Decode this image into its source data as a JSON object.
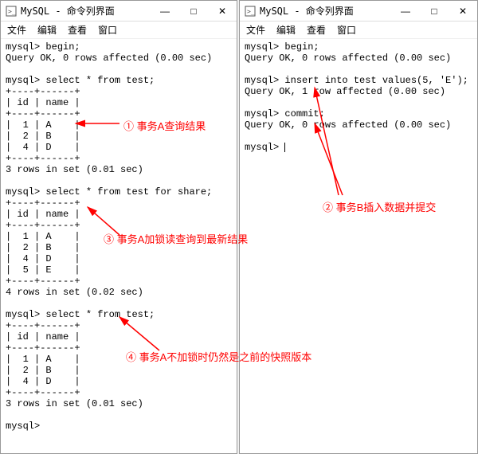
{
  "window_title": "MySQL - 命令列界面",
  "menubar": {
    "file": "文件",
    "edit": "编辑",
    "view": "查看",
    "window": "窗口"
  },
  "left": {
    "prompt": "mysql>",
    "cmd_begin": "begin;",
    "resp_begin": "Query OK, 0 rows affected (0.00 sec)",
    "cmd_select1": "select * from test;",
    "table_sep": "+----+------+",
    "table_hdr": "| id | name |",
    "row_1a": "|  1 | A    |",
    "row_2b": "|  2 | B    |",
    "row_4d": "|  4 | D    |",
    "rows3_msg": "3 rows in set (0.01 sec)",
    "cmd_select_share": "select * from test for share;",
    "row_5e": "|  5 | E    |",
    "rows4_msg": "4 rows in set (0.02 sec)",
    "cmd_select3": "select * from test;"
  },
  "right": {
    "prompt": "mysql>",
    "cmd_begin": "begin;",
    "resp_begin": "Query OK, 0 rows affected (0.00 sec)",
    "cmd_insert": "insert into test values(5, 'E');",
    "resp_insert": "Query OK, 1 row affected (0.00 sec)",
    "cmd_commit": "commit;",
    "resp_commit": "Query OK, 0 rows affected (0.00 sec)"
  },
  "anno": {
    "a1": "① 事务A查询结果",
    "a2": "② 事务B插入数据并提交",
    "a3": "③ 事务A加锁读查询到最新结果",
    "a4": "④ 事务A不加锁时仍然是之前的快照版本"
  },
  "controls": {
    "min": "—",
    "max": "□",
    "close": "✕"
  }
}
